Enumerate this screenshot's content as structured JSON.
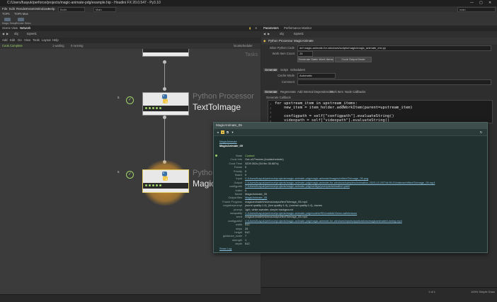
{
  "window": {
    "title": "C:/Users/fuayuk/perforce/projects/magic-animate-pdg/example.hip - Houdini FX 20.0.547 - Py3.10",
    "controls": [
      "—",
      "▢",
      "✕"
    ]
  },
  "menubar": {
    "items": [
      "File",
      "Edit",
      "Render",
      "Assets",
      "Windows",
      "Help"
    ],
    "desktop": "Build",
    "main_label": "Main",
    "search_placeholder": "main"
  },
  "shelf": {
    "tabs": [
      "TOPs",
      "TOPs Mas"
    ],
    "tools": [
      "Magic Setup",
      "Render Selec"
    ]
  },
  "network": {
    "pane_tabs": [
      "Scene View",
      "Network"
    ],
    "path": [
      "obj",
      "topnet1"
    ],
    "menu_items": [
      "Add",
      "Edit",
      "Go",
      "View",
      "Tools",
      "Layout",
      "Help"
    ],
    "status_left": "Cook Complete",
    "status_mid": "1 waiting",
    "status_right": "0 running",
    "scheduler": "localscheduler",
    "tasks_label": "Tasks",
    "nodes": [
      {
        "title": "Python Processor",
        "name": "TextToImage",
        "work_items": "5"
      },
      {
        "title": "Python Processor",
        "name": "MagicAnimate",
        "work_items": "5"
      }
    ]
  },
  "parms": {
    "pane_tabs": [
      "Parameters",
      "Performance Monitor"
    ],
    "path": [
      "obj",
      "topnet1"
    ],
    "node_type": "Python Processor",
    "node_name": "MagicAnimate",
    "work_item_generation_label": "Work Item Generation",
    "inline_code_label": "Inline Python Code",
    "inline_code": "def magic-animate-for-windows/scripts/magic/magic_animate_env.py",
    "work_items_label": "Work Item Count",
    "work_items_value": "25",
    "buttons": [
      "Generate Static Work Items",
      "Cook Output Node"
    ],
    "main_tabs": [
      "Generate",
      "Script",
      "Schedulers"
    ],
    "cache_mode_label": "Cache Mode",
    "cache_mode_value": "Automatic",
    "comment_label": "Comment",
    "sub_tabs": [
      "Generate",
      "Regenerate",
      "Add Internal Dependencies",
      "Work Item",
      "Node Callbacks"
    ],
    "section_label": "Generate Callback",
    "code_lines": [
      "for upstream_item in upstream_items:",
      "    new_item = item_holder.addWorkItem(parent=upstream_item)",
      "",
      "    configpath = self[\"configpath\"].evaluateString()",
      "    videopath = self[\"videopath\"].evaluateString()"
    ],
    "status_page": "1 of 1",
    "status_zoom": "100% Simple Draw"
  },
  "popup": {
    "title": "MagicAnimate_05",
    "header_link": "MagicAnimate",
    "header_name": "MagicAnimate_05",
    "rows": [
      {
        "k": "State",
        "v": "Cooked"
      },
      {
        "k": "Cook Info",
        "v": "Out-of-Process (localscheduler)"
      },
      {
        "k": "Cook Time",
        "v": "3209.302s (54.9m 35.687s)"
      },
      {
        "k": "Frame",
        "v": "0"
      },
      {
        "k": "Priority",
        "v": "0"
      },
      {
        "k": "Batch",
        "v": "0"
      },
      {
        "k": "Input",
        "v": "C:/Users/fuayuk/perforce/projects/magic-animate-pdg/magic-animate/images/ref/textToImage_05.png"
      },
      {
        "k": "Output",
        "v": "C:/Users/fuayuk/perforce/projects/magic-animate-pdg/magic-animate-for-windows/samples/animation-2023-12-25T16:05:21/videos/ref/textToImage_05.mp4"
      },
      {
        "k": "configpath",
        "v": "C:/Users/fuayuk/perforce/projects/magic-animate-pdg/configs/prompts/animation.yaml"
      },
      {
        "k": "Index",
        "v": "0"
      },
      {
        "k": "Name",
        "v": "MagicAnimate_05"
      },
      {
        "k": "Output files",
        "v": "MagicAnimate_05"
      },
      {
        "k": "Frame Progress",
        "v": "magicanimate5/videos/output/textToImage_05.mp4"
      },
      {
        "k": "negativeprompt",
        "v": "(worst quality:1.4), (low quality:1.4), (normal quality:1.4), lowres"
      },
      {
        "k": "prompt",
        "v": "1girl, white sweater, simple background"
      },
      {
        "k": "lowquality",
        "v": "C:/Users/fuayuk/perforce/projects/magic-animate-pdg/models/SD/realisticVision.safetensors"
      },
      {
        "k": "seed",
        "v": "magicanimate5/videos/output/textToImage_05.mp4"
      },
      {
        "k": "configpath2",
        "v": "C:/Users/fuayuk/perforce/projects/magic-animate-pdg/magic-animate-for-windows/inputs/applications/magicanimate/running.mp4"
      },
      {
        "k": "width",
        "v": "512"
      },
      {
        "k": "steps",
        "v": "25"
      },
      {
        "k": "height",
        "v": "512"
      },
      {
        "k": "guidance_scale",
        "v": "7"
      },
      {
        "k": "strength",
        "v": "1"
      },
      {
        "k": "depth",
        "v": "512"
      }
    ],
    "footer_link": "Show Log"
  },
  "colors": {
    "accent_green": "#9fd36a",
    "node_highlight": "#e39a2b",
    "popup_bg": "#213130"
  }
}
